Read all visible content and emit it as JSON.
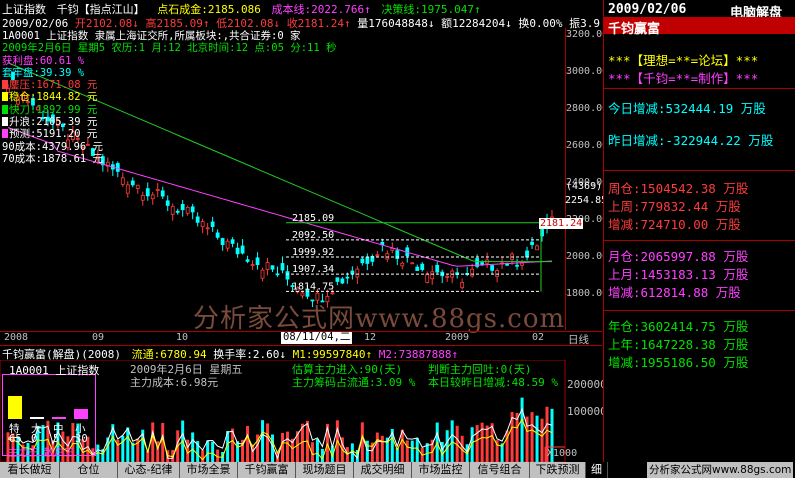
{
  "colors": {
    "up": "#ff3b3b",
    "down": "#00ffff",
    "ma_magenta": "#ff40ff",
    "ma_green": "#22cc22",
    "yellow": "#ffff00",
    "cyan": "#00ffff",
    "white": "#ffffff",
    "border": "#aa0000"
  },
  "header": {
    "row1": {
      "name": "上证指数",
      "author": "千钧【指点江山】",
      "stone_cost": "点石成金:2185.086",
      "cost_line": "成本线:2022.766↑",
      "decision_line": "决策线:1975.047↑"
    },
    "row2": {
      "date": "2009/02/06",
      "open": "开2102.08↓",
      "high": "高2185.09↑",
      "low": "低2102.08↓",
      "close": "收2181.24↑",
      "volume": "量176048848↓",
      "amount": "额12284204↓",
      "turnover": "换0.00%",
      "amplitude": "振3.9"
    }
  },
  "info": {
    "line1": "1A0001 上证指数 隶属上海证交所,所属板块:,共合证券:0 家",
    "line2": "2009年2月6日 星期5 农历:1 月:12 北京时间:12 点:05 分:11 秒",
    "profit_label": "获利盘:",
    "profit_value": "60.61 %",
    "trapped_label": "套牢盘:",
    "trapped_value": "39.39 %",
    "items": [
      {
        "label": "鏖压:",
        "value": "1671.08 元",
        "color": "#ff3b3b",
        "sq": "#ff3b3b"
      },
      {
        "label": "稳仓:",
        "value": "1844.82 元",
        "color": "#ffff00",
        "sq": "#ffff00"
      },
      {
        "label": "快刀:",
        "value": "1892.99 元",
        "color": "#00e000",
        "sq": "#00e000"
      },
      {
        "label": "升浪:",
        "value": "2105.39 元",
        "color": "#ffffff",
        "sq": "#ffffff"
      },
      {
        "label": "预测:",
        "value": "5191.20 元",
        "color": "#ffffff",
        "sq": "#ff40ff"
      },
      {
        "label": "90成本:",
        "value": "4379.96 元",
        "color": "#ffffff",
        "sq": ""
      },
      {
        "label": "70成本:",
        "value": "1878.61 元",
        "color": "#ffffff",
        "sq": ""
      }
    ]
  },
  "price_axis": {
    "ticks": [
      "3200.00",
      "3000.00",
      "2800.00",
      "2600.00",
      "2400.00",
      "2200.00",
      "2000.00",
      "1800.00"
    ],
    "count_label": "(4369)",
    "current_label": "2254.85",
    "close_tag": "2181.24"
  },
  "levels": [
    "2185.09",
    "2092.50",
    "1999.92",
    "1907.34",
    "1814.75"
  ],
  "watermark": "分析家公式网www.88gs.com",
  "cursor_date": "08/11/04,二",
  "time_axis": [
    "2008",
    "09",
    "10",
    "12",
    "2009",
    "02"
  ],
  "time_axis_label": "日线",
  "sub_header": {
    "title": "千钧赢富(解盘)(2008)",
    "circulation": "流通:6780.94",
    "turnover_rate": "换手率:2.60↓",
    "m1": "M1:99597840↑",
    "m2": "M2:73887888↑"
  },
  "sub_info": {
    "code": "1A0001 上证指数",
    "date_line": "2009年2月6日 星期五",
    "main_cost": "主力成本:6.98元",
    "est_main": "估算主力进入:90(天)",
    "judge": "判断主力回吐:0(天)",
    "chip_ratio": "主力筹码占流通:3.09 %",
    "increase": "本日较昨日增减:48.59 %"
  },
  "sub_axis": {
    "ticks": [
      "200000",
      "100000"
    ],
    "x_label": "X1000"
  },
  "mini_bars": [
    {
      "label": "特",
      "value": "65"
    },
    {
      "label": "大",
      "value": "0"
    },
    {
      "label": "中",
      "value": "5"
    },
    {
      "label": "小",
      "value": "30"
    }
  ],
  "mini_caption": "主力王 散户王 ",
  "panel": {
    "date": "2009/02/06",
    "title_right": "电脑解盘",
    "app_title": "千钧赢富",
    "slogan1": "***【理想=**=论坛】***",
    "slogan2": "***【千钧=**=制作】***",
    "today_change_label": "今日增减:",
    "today_change_value": "532444.19 万股",
    "yesterday_change_label": "昨日增减:",
    "yesterday_change_value": "-322944.22 万股",
    "week": [
      {
        "label": "周仓:",
        "value": "1504542.38 万股"
      },
      {
        "label": "上周:",
        "value": "779832.44 万股"
      },
      {
        "label": "增减:",
        "value": "724710.00 万股"
      }
    ],
    "month": [
      {
        "label": "月仓:",
        "value": "2065997.88 万股"
      },
      {
        "label": "上月:",
        "value": "1453183.13 万股"
      },
      {
        "label": "增减:",
        "value": "612814.88 万股"
      }
    ],
    "year": [
      {
        "label": "年仓:",
        "value": "3602414.75 万股"
      },
      {
        "label": "上年:",
        "value": "1647228.38 万股"
      },
      {
        "label": "增减:",
        "value": "1955186.50 万股"
      }
    ]
  },
  "tabs": [
    {
      "label": "看长做短",
      "active": false
    },
    {
      "label": "仓位",
      "active": false
    },
    {
      "label": "心态-纪律",
      "active": false
    },
    {
      "label": "市场全景",
      "active": false
    },
    {
      "label": "千钧赢富",
      "active": false
    },
    {
      "label": "现场题目",
      "active": false
    },
    {
      "label": "成交明细",
      "active": false
    },
    {
      "label": "市场监控",
      "active": false
    },
    {
      "label": "信号组合",
      "active": false
    },
    {
      "label": "下跌预测",
      "active": false
    },
    {
      "label": "细",
      "active": true
    }
  ],
  "footer_watermark": "分析家公式网www.88gs.com"
}
